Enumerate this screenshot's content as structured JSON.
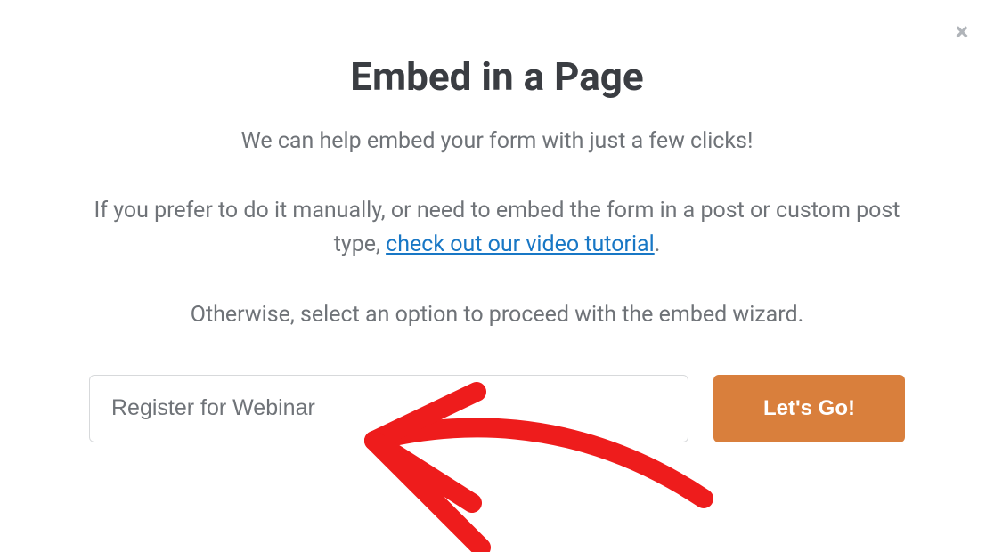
{
  "modal": {
    "title": "Embed in a Page",
    "subtitle": "We can help embed your form with just a few clicks!",
    "body_prefix": "If you prefer to do it manually, or need to embed the form in a post or custom post type, ",
    "body_link": "check out our video tutorial",
    "body_suffix": ".",
    "wizard_text": "Otherwise, select an option to proceed with the embed wizard.",
    "input_value": "Register for Webinar",
    "go_button": "Let's Go!",
    "close_icon": "×"
  },
  "annotation": {
    "arrow_color": "#ee1c1c"
  }
}
